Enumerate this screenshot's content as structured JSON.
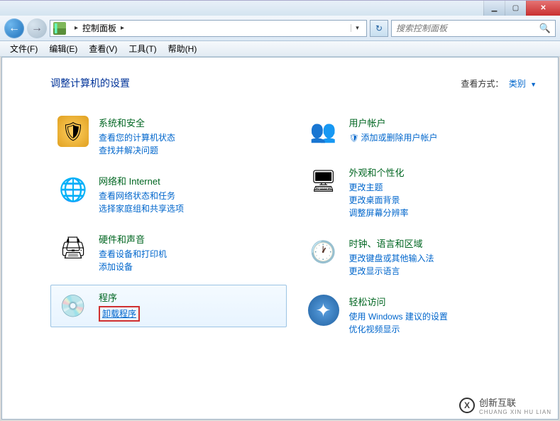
{
  "window": {
    "title": "控制面板"
  },
  "nav": {
    "breadcrumb_sep": "▸",
    "location": "控制面板",
    "search_placeholder": "搜索控制面板"
  },
  "menu": {
    "file": "文件(F)",
    "edit": "编辑(E)",
    "view": "查看(V)",
    "tools": "工具(T)",
    "help": "帮助(H)"
  },
  "header": {
    "title": "调整计算机的设置",
    "view_label": "查看方式：",
    "view_value": "类别"
  },
  "categories": {
    "left": [
      {
        "title": "系统和安全",
        "links": [
          "查看您的计算机状态",
          "查找并解决问题"
        ],
        "icon": "ic-shield"
      },
      {
        "title": "网络和 Internet",
        "links": [
          "查看网络状态和任务",
          "选择家庭组和共享选项"
        ],
        "icon": "ic-net"
      },
      {
        "title": "硬件和声音",
        "links": [
          "查看设备和打印机",
          "添加设备"
        ],
        "icon": "ic-hw"
      },
      {
        "title": "程序",
        "links": [
          "卸载程序"
        ],
        "icon": "ic-prog",
        "highlighted": true,
        "boxedLink": 0
      }
    ],
    "right": [
      {
        "title": "用户帐户",
        "links": [
          "添加或删除用户帐户"
        ],
        "icon": "ic-user",
        "shield": true
      },
      {
        "title": "外观和个性化",
        "links": [
          "更改主题",
          "更改桌面背景",
          "调整屏幕分辨率"
        ],
        "icon": "ic-appr"
      },
      {
        "title": "时钟、语言和区域",
        "links": [
          "更改键盘或其他输入法",
          "更改显示语言"
        ],
        "icon": "ic-clock"
      },
      {
        "title": "轻松访问",
        "links": [
          "使用 Windows 建议的设置",
          "优化视频显示"
        ],
        "icon": "ic-ease"
      }
    ]
  },
  "watermark": {
    "brand": "创新互联",
    "sub": "CHUANG XIN HU LIAN",
    "logo": "X"
  }
}
